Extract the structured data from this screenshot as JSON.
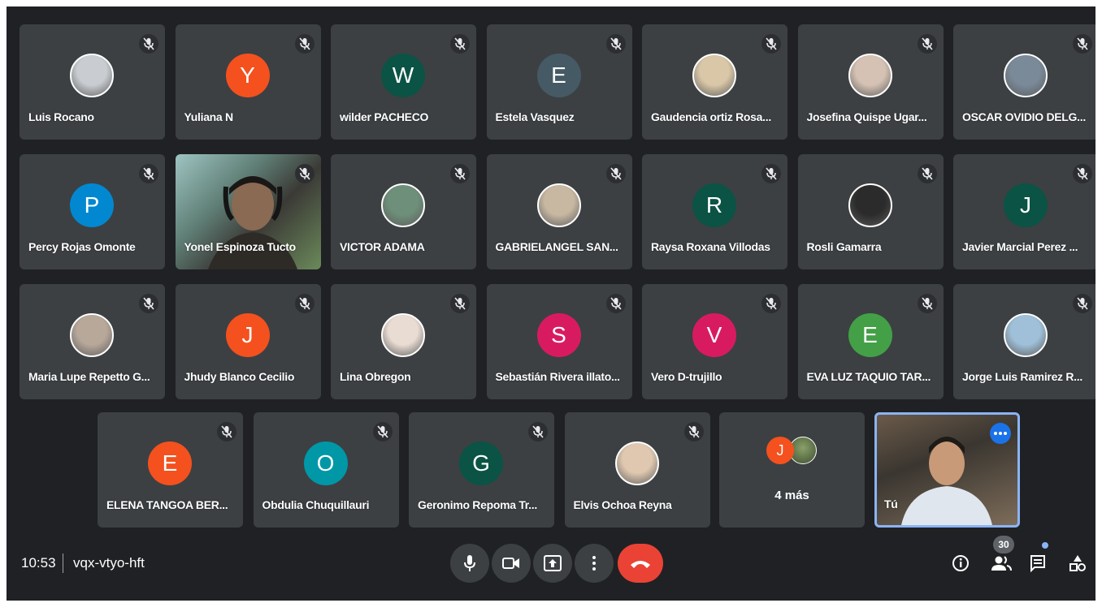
{
  "meeting": {
    "time": "10:53",
    "code": "vqx-vtyo-hft",
    "participant_count": "30"
  },
  "colors": {
    "background": "#202124",
    "tile": "#3c4043",
    "hangup": "#ea4335",
    "accent": "#1a73e8"
  },
  "participants": [
    {
      "name": "Luis Rocano",
      "initial": "",
      "avatar_color": "#c9cdd1"
    },
    {
      "name": "Yuliana N",
      "initial": "Y",
      "avatar_color": "#f4511e"
    },
    {
      "name": "wilder PACHECO",
      "initial": "W",
      "avatar_color": "#0b5345"
    },
    {
      "name": "Estela Vasquez",
      "initial": "E",
      "avatar_color": "#455a64"
    },
    {
      "name": "Gaudencia ortiz Rosa...",
      "initial": "",
      "avatar_color": "#d9c7a7"
    },
    {
      "name": "Josefina Quispe Ugar...",
      "initial": "",
      "avatar_color": "#d6c2b4"
    },
    {
      "name": "OSCAR OVIDIO DELG...",
      "initial": "",
      "avatar_color": "#7a8a99"
    },
    {
      "name": "Percy Rojas Omonte",
      "initial": "P",
      "avatar_color": "#0288d1"
    },
    {
      "name": "Yonel Espinoza Tucto",
      "initial": "",
      "avatar_color": ""
    },
    {
      "name": "VICTOR ADAMA",
      "initial": "",
      "avatar_color": "#6e8f7a"
    },
    {
      "name": "GABRIELANGEL SAN...",
      "initial": "",
      "avatar_color": "#c8b8a2"
    },
    {
      "name": "Raysa Roxana Villodas",
      "initial": "R",
      "avatar_color": "#0b5345"
    },
    {
      "name": "Rosli Gamarra",
      "initial": "",
      "avatar_color": "#2b2b2b"
    },
    {
      "name": "Javier Marcial Perez ...",
      "initial": "J",
      "avatar_color": "#0b5345"
    },
    {
      "name": "Maria Lupe Repetto G...",
      "initial": "",
      "avatar_color": "#b8a89a"
    },
    {
      "name": "Jhudy Blanco Cecilio",
      "initial": "J",
      "avatar_color": "#f4511e"
    },
    {
      "name": "Lina Obregon",
      "initial": "",
      "avatar_color": "#e9dcd3"
    },
    {
      "name": "Sebastián Rivera illato...",
      "initial": "S",
      "avatar_color": "#d81b60"
    },
    {
      "name": "Vero D-trujillo",
      "initial": "V",
      "avatar_color": "#d81b60"
    },
    {
      "name": "EVA LUZ TAQUIO TAR...",
      "initial": "E",
      "avatar_color": "#43a047"
    },
    {
      "name": "Jorge Luis Ramirez R...",
      "initial": "",
      "avatar_color": "#9fc0d8"
    },
    {
      "name": "ELENA TANGOA BER...",
      "initial": "E",
      "avatar_color": "#f4511e"
    },
    {
      "name": "Obdulia Chuquillauri",
      "initial": "O",
      "avatar_color": "#0097a7"
    },
    {
      "name": "Geronimo Repoma Tr...",
      "initial": "G",
      "avatar_color": "#0b5345"
    },
    {
      "name": "Elvis Ochoa Reyna",
      "initial": "",
      "avatar_color": "#e0c8b0"
    }
  ],
  "more_tile": {
    "label": "4 más",
    "initial": "J",
    "initial_color": "#f4511e"
  },
  "self_tile": {
    "label": "Tú"
  }
}
